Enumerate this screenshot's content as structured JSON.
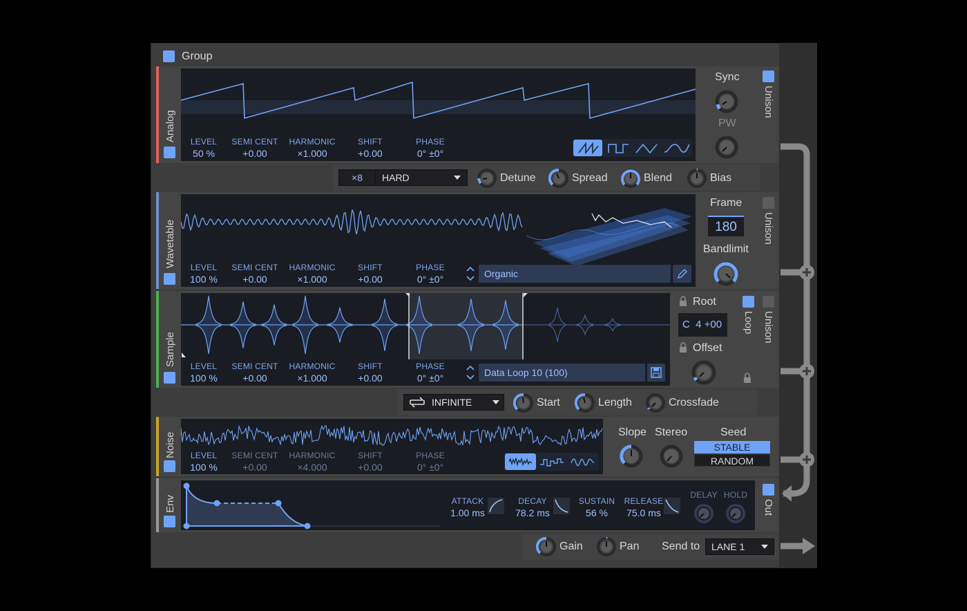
{
  "group": {
    "label": "Group"
  },
  "params": {
    "level": "LEVEL",
    "semi_cent": "SEMI CENT",
    "harmonic": "HARMONIC",
    "shift": "SHIFT",
    "phase": "PHASE"
  },
  "analog": {
    "title": "Analog",
    "level": "50 %",
    "semi_cent": "+0.00",
    "harmonic": "×1.000",
    "shift": "+0.00",
    "phase": "0° ±0°",
    "sync": "Sync",
    "pw": "PW",
    "unison": "Unison",
    "waveforms": [
      "saw-wave-icon",
      "square-wave-icon",
      "triangle-wave-icon",
      "sine-wave-icon"
    ],
    "selected_waveform": "saw-wave-icon",
    "unison_voices": "×8",
    "unison_mode": "HARD",
    "detune": "Detune",
    "spread": "Spread",
    "blend": "Blend",
    "bias": "Bias"
  },
  "wavetable": {
    "title": "Wavetable",
    "level": "100 %",
    "semi_cent": "+0.00",
    "harmonic": "×1.000",
    "shift": "+0.00",
    "phase": "0° ±0°",
    "preset": "Organic",
    "frame_label": "Frame",
    "frame_value": "180",
    "bandlimit": "Bandlimit",
    "unison": "Unison"
  },
  "sample": {
    "title": "Sample",
    "level": "100 %",
    "semi_cent": "+0.00",
    "harmonic": "×1.000",
    "shift": "+0.00",
    "phase": "0° ±0°",
    "preset": "Data Loop 10 (100)",
    "root": "Root",
    "root_value": "C  4 +00",
    "offset": "Offset",
    "loop": "Loop",
    "unison": "Unison",
    "loop_mode": "INFINITE",
    "start": "Start",
    "length": "Length",
    "crossfade": "Crossfade"
  },
  "noise": {
    "title": "Noise",
    "level": "100 %",
    "semi_cent": "+0.00",
    "harmonic": "×4.000",
    "shift": "+0.00",
    "phase": "0° ±0°",
    "slope": "Slope",
    "stereo": "Stereo",
    "seed": "Seed",
    "seed_options": [
      "STABLE",
      "RANDOM"
    ],
    "seed_selected": "STABLE",
    "types": [
      "noise-white-icon",
      "noise-stepped-icon",
      "noise-smooth-icon"
    ]
  },
  "env": {
    "title": "Env",
    "out": "Out",
    "attack_label": "ATTACK",
    "attack": "1.00 ms",
    "decay_label": "DECAY",
    "decay": "78.2 ms",
    "sustain_label": "SUSTAIN",
    "sustain": "56 %",
    "release_label": "RELEASE",
    "release": "75.0 ms",
    "delay_label": "DELAY",
    "hold_label": "HOLD"
  },
  "output": {
    "gain": "Gain",
    "pan": "Pan",
    "send_to": "Send to",
    "lane": "LANE 1"
  },
  "colors": {
    "accent": "#6fa3f7",
    "analog": "#e0625a",
    "wavetable": "#6f8fd0",
    "sample": "#4caf50",
    "noise": "#c9a227",
    "env": "#9a9a9a"
  }
}
